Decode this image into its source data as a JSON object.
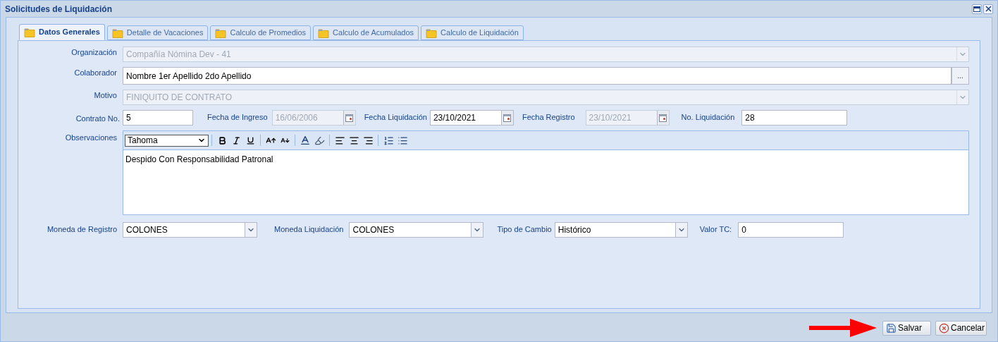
{
  "window": {
    "title": "Solicitudes de Liquidación"
  },
  "tabs": [
    {
      "label": "Datos Generales",
      "selected": true
    },
    {
      "label": "Detalle de Vacaciones",
      "selected": false
    },
    {
      "label": "Calculo de Promedios",
      "selected": false
    },
    {
      "label": "Calculo de Acumulados",
      "selected": false
    },
    {
      "label": "Calculo de Liquidación",
      "selected": false
    }
  ],
  "form": {
    "organizacion": {
      "label": "Organización",
      "value": "Compañía Nómina Dev - 41",
      "disabled": true
    },
    "colaborador": {
      "label": "Colaborador",
      "value": "Nombre 1er Apellido 2do Apellido",
      "disabled": false,
      "button": "..."
    },
    "motivo": {
      "label": "Motivo",
      "value": "FINIQUITO DE CONTRATO",
      "disabled": true
    },
    "contrato": {
      "label": "Contrato No.",
      "value": "5",
      "disabled": false
    },
    "fecha_ingreso": {
      "label": "Fecha de Ingreso",
      "value": "16/06/2006",
      "disabled": true
    },
    "fecha_liquidacion": {
      "label": "Fecha Liquidación",
      "value": "23/10/2021",
      "disabled": false
    },
    "fecha_registro": {
      "label": "Fecha Registro",
      "value": "23/10/2021",
      "disabled": true
    },
    "no_liquidacion": {
      "label": "No. Liquidación",
      "value": "28",
      "disabled": false
    },
    "observaciones": {
      "label": "Observaciones",
      "font": "Tahoma",
      "text": "Despido Con Responsabilidad Patronal"
    },
    "moneda_registro": {
      "label": "Moneda de Registro",
      "value": "COLONES",
      "disabled": false
    },
    "moneda_liquidacion": {
      "label": "Moneda Liquidación",
      "value": "COLONES",
      "disabled": false
    },
    "tipo_cambio": {
      "label": "Tipo de Cambio",
      "value": "Histórico",
      "disabled": false
    },
    "valor_tc": {
      "label": "Valor TC:",
      "value": "0",
      "disabled": false
    }
  },
  "buttons": [
    {
      "label": "Salvar",
      "kind": "save"
    },
    {
      "label": "Cancelar",
      "kind": "cancel"
    }
  ]
}
